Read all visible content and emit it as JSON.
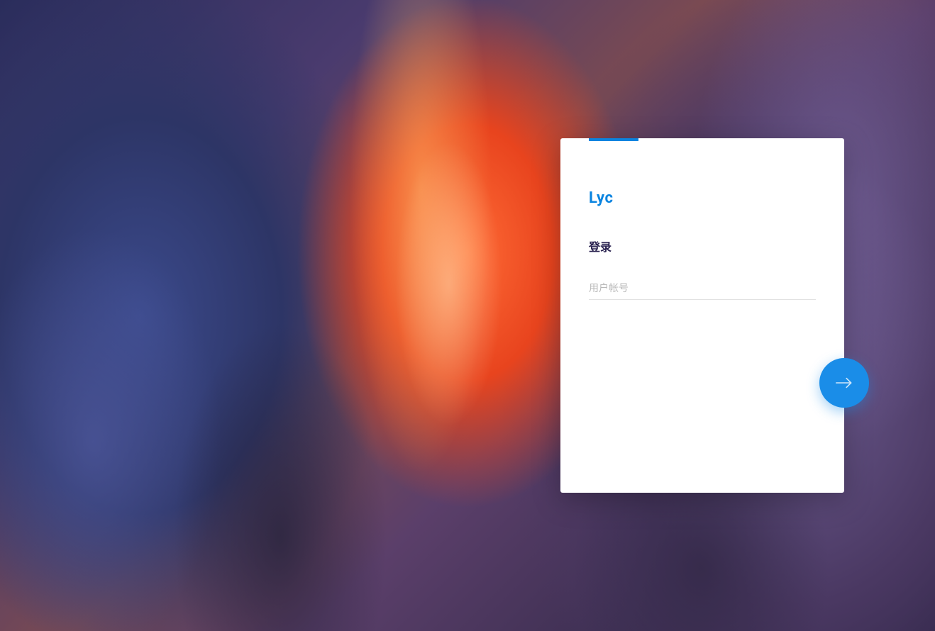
{
  "login": {
    "brand": "Lyc",
    "title": "登录",
    "username_placeholder": "用户帐号",
    "username_value": ""
  },
  "colors": {
    "accent": "#0a84e0",
    "button": "#1a8de8",
    "title": "#2a2250"
  }
}
